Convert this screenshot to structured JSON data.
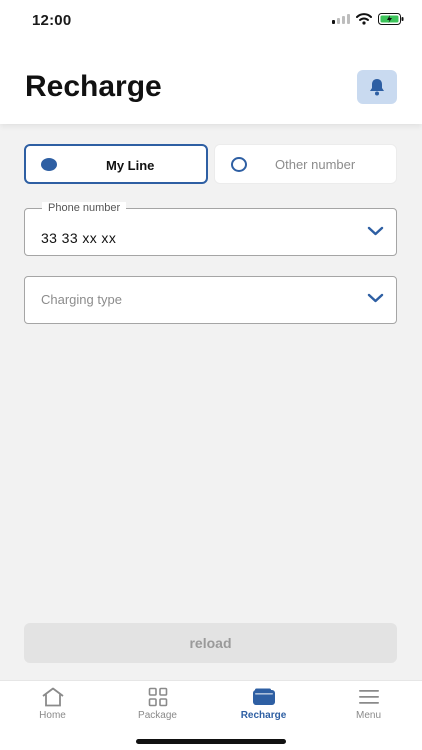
{
  "status_bar": {
    "time": "12:00",
    "icons": [
      "signal-icon",
      "wifi-icon",
      "battery-charging-icon"
    ]
  },
  "header": {
    "title": "Recharge",
    "notification_icon": "bell-icon"
  },
  "line_selector": {
    "options": [
      {
        "label": "My Line",
        "selected": true
      },
      {
        "label": "Other number",
        "selected": false
      }
    ]
  },
  "phone_field": {
    "label": "Phone number",
    "value": "33 33 xx xx",
    "icon": "chevron-down-icon"
  },
  "charging_field": {
    "placeholder": "Charging type",
    "icon": "chevron-down-icon"
  },
  "reload_button": {
    "label": "reload",
    "enabled": false
  },
  "tab_bar": {
    "tabs": [
      {
        "label": "Home",
        "icon": "home-icon",
        "active": false
      },
      {
        "label": "Package",
        "icon": "grid-icon",
        "active": false
      },
      {
        "label": "Recharge",
        "icon": "wallet-icon",
        "active": true
      },
      {
        "label": "Menu",
        "icon": "menu-icon",
        "active": false
      }
    ]
  },
  "colors": {
    "accent": "#2e5fa3",
    "accent_light": "#c9daf0",
    "background": "#f2f2f2",
    "inactive_text": "#8a8a8a"
  }
}
